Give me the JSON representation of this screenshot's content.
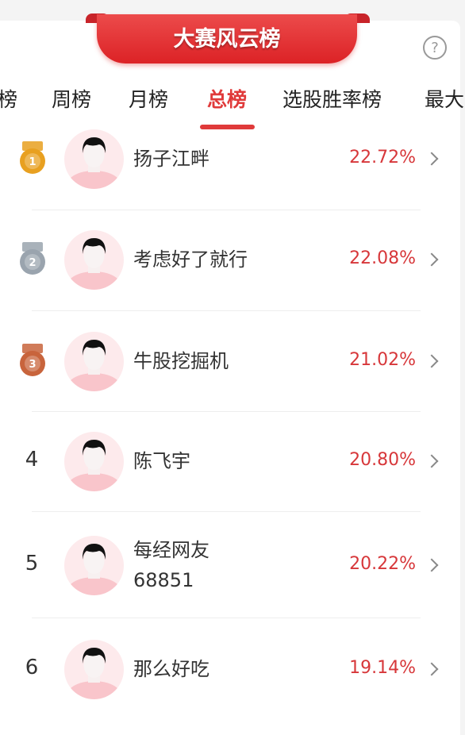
{
  "header": {
    "title": "大赛风云榜",
    "help_icon": "question-circle-icon"
  },
  "tabs": [
    {
      "label": "榜"
    },
    {
      "label": "周榜"
    },
    {
      "label": "月榜"
    },
    {
      "label": "总榜",
      "active": true
    },
    {
      "label": "选股胜率榜"
    },
    {
      "label": "最大"
    }
  ],
  "colors": {
    "accent": "#e03a3a",
    "gold": "#e8a020",
    "silver": "#9aa4ae",
    "bronze": "#c8643c"
  },
  "rows": [
    {
      "rank": "1",
      "medal": "gold",
      "name": "扬子江畔",
      "pct": "22.72%"
    },
    {
      "rank": "2",
      "medal": "silver",
      "name": "考虑好了就行",
      "pct": "22.08%"
    },
    {
      "rank": "3",
      "medal": "bronze",
      "name": "牛股挖掘机",
      "pct": "21.02%"
    },
    {
      "rank": "4",
      "name": "陈飞宇",
      "pct": "20.80%"
    },
    {
      "rank": "5",
      "name": "每经网友\n68851",
      "pct": "20.22%"
    },
    {
      "rank": "6",
      "name": "那么好吃",
      "pct": "19.14%"
    }
  ]
}
